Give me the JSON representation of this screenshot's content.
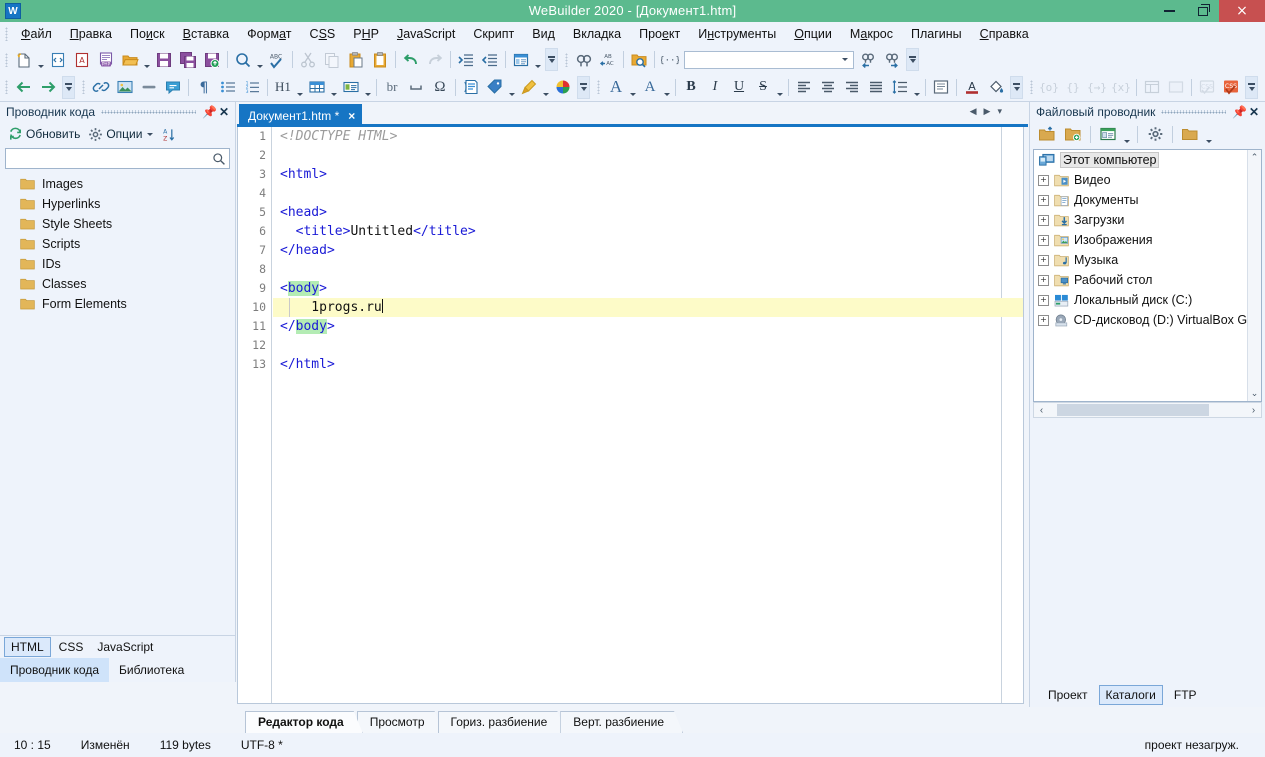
{
  "window": {
    "title": "WeBuilder 2020 - [Документ1.htm]",
    "app_icon": "W",
    "accent_title_bg": "#5cba8e",
    "close_btn_bg": "#c75050",
    "minimize_label": "minimize-icon",
    "maximize_label": "restore-icon",
    "close_label": "×"
  },
  "menubar": {
    "items": [
      {
        "label": "Файл",
        "accel_index": 0
      },
      {
        "label": "Правка",
        "accel_index": 0
      },
      {
        "label": "Поиск",
        "accel_index": 2
      },
      {
        "label": "Вставка",
        "accel_index": 0
      },
      {
        "label": "Формат",
        "accel_index": 4
      },
      {
        "label": "CSS",
        "accel_index": 2
      },
      {
        "label": "PHP",
        "accel_index": 1
      },
      {
        "label": "JavaScript",
        "accel_index": 0
      },
      {
        "label": "Скрипт",
        "accel_index": -1
      },
      {
        "label": "Вид",
        "accel_index": -1
      },
      {
        "label": "Вкладка",
        "accel_index": -1
      },
      {
        "label": "Проект",
        "accel_index": 3
      },
      {
        "label": "Инструменты",
        "accel_index": 2
      },
      {
        "label": "Опции",
        "accel_index": 0
      },
      {
        "label": "Макрос",
        "accel_index": 1
      },
      {
        "label": "Плагины",
        "accel_index": -1
      },
      {
        "label": "Справка",
        "accel_index": 0
      }
    ]
  },
  "toolbar_row1": {
    "items": [
      {
        "name": "new-file-icon",
        "type": "button"
      },
      {
        "name": "new-file-dropdown",
        "type": "caret"
      },
      {
        "name": "new-from-template-icon",
        "type": "button"
      },
      {
        "name": "new-asp-icon",
        "type": "button"
      },
      {
        "name": "new-php-icon",
        "type": "button"
      },
      {
        "name": "open-file-icon",
        "type": "button"
      },
      {
        "name": "open-file-dropdown",
        "type": "caret"
      },
      {
        "name": "save-icon",
        "type": "button"
      },
      {
        "name": "save-all-icon",
        "type": "button"
      },
      {
        "name": "save-upload-icon",
        "type": "button"
      },
      {
        "name": "separator",
        "type": "sep"
      },
      {
        "name": "preview-search-icon",
        "type": "button"
      },
      {
        "name": "preview-dropdown",
        "type": "caret"
      },
      {
        "name": "spellcheck-icon",
        "type": "button"
      },
      {
        "name": "separator",
        "type": "sep"
      },
      {
        "name": "cut-icon",
        "type": "button",
        "disabled": true
      },
      {
        "name": "copy-icon",
        "type": "button",
        "disabled": true
      },
      {
        "name": "paste-icon",
        "type": "button"
      },
      {
        "name": "clipboard-icon",
        "type": "button"
      },
      {
        "name": "separator",
        "type": "sep"
      },
      {
        "name": "undo-icon",
        "type": "button"
      },
      {
        "name": "redo-icon",
        "type": "button",
        "disabled": true
      },
      {
        "name": "separator",
        "type": "sep"
      },
      {
        "name": "indent-icon",
        "type": "button"
      },
      {
        "name": "outdent-icon",
        "type": "button"
      },
      {
        "name": "separator",
        "type": "sep"
      },
      {
        "name": "layout-icon",
        "type": "button"
      },
      {
        "name": "layout-dropdown",
        "type": "caret"
      },
      {
        "name": "overflow-chevron",
        "type": "more"
      },
      {
        "name": "grip",
        "type": "grip"
      },
      {
        "name": "find-icon",
        "type": "button"
      },
      {
        "name": "replace-icon",
        "type": "button"
      },
      {
        "name": "separator",
        "type": "sep"
      },
      {
        "name": "find-in-files-icon",
        "type": "button"
      },
      {
        "name": "separator",
        "type": "sep"
      },
      {
        "name": "snippet-icon",
        "type": "button"
      },
      {
        "name": "quick-find-combo",
        "type": "combo",
        "value": "",
        "placeholder": ""
      },
      {
        "name": "find-previous-icon",
        "type": "button"
      },
      {
        "name": "find-next-icon",
        "type": "button"
      },
      {
        "name": "overflow-chevron",
        "type": "more"
      }
    ]
  },
  "toolbar_row2": {
    "items": [
      {
        "name": "back-icon",
        "type": "button"
      },
      {
        "name": "forward-icon",
        "type": "button"
      },
      {
        "name": "overflow-chevron",
        "type": "more"
      },
      {
        "name": "grip",
        "type": "grip"
      },
      {
        "name": "insert-link-icon",
        "type": "button"
      },
      {
        "name": "insert-image-icon",
        "type": "button"
      },
      {
        "name": "horizontal-rule-icon",
        "type": "button"
      },
      {
        "name": "comment-icon",
        "type": "button"
      },
      {
        "name": "separator",
        "type": "sep"
      },
      {
        "name": "paragraph-icon",
        "type": "button"
      },
      {
        "name": "bullet-list-icon",
        "type": "button"
      },
      {
        "name": "numbered-list-icon",
        "type": "button"
      },
      {
        "name": "separator",
        "type": "sep"
      },
      {
        "name": "heading-icon",
        "type": "button",
        "text": "H1"
      },
      {
        "name": "heading-dropdown",
        "type": "caret"
      },
      {
        "name": "table-icon",
        "type": "button"
      },
      {
        "name": "table-dropdown",
        "type": "caret"
      },
      {
        "name": "form-icon",
        "type": "button"
      },
      {
        "name": "form-dropdown",
        "type": "caret"
      },
      {
        "name": "separator",
        "type": "sep"
      },
      {
        "name": "line-break-icon",
        "type": "button",
        "text": "br"
      },
      {
        "name": "nbsp-icon",
        "type": "button"
      },
      {
        "name": "special-char-icon",
        "type": "button"
      },
      {
        "name": "separator",
        "type": "sep"
      },
      {
        "name": "meta-tags-icon",
        "type": "button"
      },
      {
        "name": "tag-icon",
        "type": "button"
      },
      {
        "name": "tag-dropdown",
        "type": "caret"
      },
      {
        "name": "style-brush-icon",
        "type": "button"
      },
      {
        "name": "style-dropdown",
        "type": "caret"
      },
      {
        "name": "color-picker-icon",
        "type": "button"
      },
      {
        "name": "overflow-chevron",
        "type": "more"
      },
      {
        "name": "grip",
        "type": "grip"
      },
      {
        "name": "font-icon",
        "type": "button",
        "text": "A"
      },
      {
        "name": "font-dropdown",
        "type": "caret"
      },
      {
        "name": "font-size-icon",
        "type": "button",
        "text": "A"
      },
      {
        "name": "font-size-dropdown",
        "type": "caret"
      },
      {
        "name": "separator",
        "type": "sep"
      },
      {
        "name": "bold-icon",
        "type": "button",
        "text": "B"
      },
      {
        "name": "italic-icon",
        "type": "button",
        "text": "I"
      },
      {
        "name": "underline-icon",
        "type": "button",
        "text": "U"
      },
      {
        "name": "strikethrough-icon",
        "type": "button",
        "text": "S"
      },
      {
        "name": "strikethrough-dropdown",
        "type": "caret"
      },
      {
        "name": "separator",
        "type": "sep"
      },
      {
        "name": "align-left-icon",
        "type": "button"
      },
      {
        "name": "align-center-icon",
        "type": "button"
      },
      {
        "name": "align-right-icon",
        "type": "button"
      },
      {
        "name": "align-justify-icon",
        "type": "button"
      },
      {
        "name": "line-height-icon",
        "type": "button"
      },
      {
        "name": "line-height-dropdown",
        "type": "caret"
      },
      {
        "name": "separator",
        "type": "sep"
      },
      {
        "name": "div-block-icon",
        "type": "button"
      },
      {
        "name": "separator",
        "type": "sep"
      },
      {
        "name": "font-color-icon",
        "type": "button"
      },
      {
        "name": "background-color-icon",
        "type": "button"
      },
      {
        "name": "overflow-chevron",
        "type": "more"
      },
      {
        "name": "grip",
        "type": "grip"
      },
      {
        "name": "php-open-icon",
        "type": "button",
        "disabled": true
      },
      {
        "name": "php-braces-icon",
        "type": "button",
        "disabled": true
      },
      {
        "name": "php-echo-icon",
        "type": "button",
        "disabled": true
      },
      {
        "name": "php-var-icon",
        "type": "button",
        "disabled": true
      },
      {
        "name": "separator",
        "type": "sep"
      },
      {
        "name": "frame-icon",
        "type": "button",
        "disabled": true
      },
      {
        "name": "panel-icon",
        "type": "button",
        "disabled": true
      },
      {
        "name": "separator",
        "type": "sep"
      },
      {
        "name": "css-validate-icon",
        "type": "button",
        "disabled": true
      },
      {
        "name": "css-check-icon",
        "type": "button"
      },
      {
        "name": "overflow-chevron",
        "type": "more"
      }
    ]
  },
  "left_panel": {
    "title": "Проводник кода",
    "pin_icon": "pin-icon",
    "close_icon": "close-icon",
    "toolbar": {
      "refresh_label": "Обновить",
      "options_label": "Опции",
      "sort_label": "sort-az-icon"
    },
    "search": {
      "value": "",
      "placeholder": ""
    },
    "tree_items": [
      {
        "label": "Images",
        "icon": "folder-icon"
      },
      {
        "label": "Hyperlinks",
        "icon": "folder-icon"
      },
      {
        "label": "Style Sheets",
        "icon": "folder-icon"
      },
      {
        "label": "Scripts",
        "icon": "folder-icon"
      },
      {
        "label": "IDs",
        "icon": "folder-icon"
      },
      {
        "label": "Classes",
        "icon": "folder-icon"
      },
      {
        "label": "Form Elements",
        "icon": "folder-icon"
      }
    ],
    "lang_buttons": [
      {
        "label": "HTML",
        "active": true
      },
      {
        "label": "CSS",
        "active": false
      },
      {
        "label": "JavaScript",
        "active": false
      }
    ],
    "bottom_tabs": [
      {
        "label": "Проводник кода",
        "active": true
      },
      {
        "label": "Библиотека",
        "active": false
      }
    ]
  },
  "editor": {
    "document_tab": {
      "label": "Документ1.htm *",
      "close": "×"
    },
    "nav": {
      "prev": "◀",
      "next": "▶",
      "list": "▾"
    },
    "lines": [
      {
        "num": 1,
        "segments": [
          {
            "text": "<!DOCTYPE HTML>",
            "cls": "tok-doctype"
          }
        ]
      },
      {
        "num": 2,
        "segments": []
      },
      {
        "num": 3,
        "segments": [
          {
            "text": "<html>",
            "cls": "tok-tag"
          }
        ]
      },
      {
        "num": 4,
        "segments": []
      },
      {
        "num": 5,
        "segments": [
          {
            "text": "<head>",
            "cls": "tok-tag"
          }
        ]
      },
      {
        "num": 6,
        "segments": [
          {
            "text": "  <title>",
            "cls": "tok-tag"
          },
          {
            "text": "Untitled",
            "cls": "tok-txt"
          },
          {
            "text": "</title>",
            "cls": "tok-tag"
          }
        ]
      },
      {
        "num": 7,
        "segments": [
          {
            "text": "</head>",
            "cls": "tok-tag"
          }
        ]
      },
      {
        "num": 8,
        "segments": []
      },
      {
        "num": 9,
        "segments": [
          {
            "text": "<",
            "cls": "tok-tag"
          },
          {
            "text": "body",
            "cls": "tok-match"
          },
          {
            "text": ">",
            "cls": "tok-tag"
          }
        ]
      },
      {
        "num": 10,
        "current": true,
        "segments": [
          {
            "text": "    1progs.ru",
            "cls": "tok-txt"
          }
        ],
        "caret": true
      },
      {
        "num": 11,
        "segments": [
          {
            "text": "</",
            "cls": "tok-tag"
          },
          {
            "text": "body",
            "cls": "tok-match"
          },
          {
            "text": ">",
            "cls": "tok-tag"
          }
        ]
      },
      {
        "num": 12,
        "segments": []
      },
      {
        "num": 13,
        "segments": [
          {
            "text": "</html>",
            "cls": "tok-tag"
          }
        ]
      }
    ],
    "view_tabs": [
      {
        "label": "Редактор кода",
        "active": true
      },
      {
        "label": "Просмотр",
        "active": false
      },
      {
        "label": "Гориз. разбиение",
        "active": false
      },
      {
        "label": "Верт. разбиение",
        "active": false
      }
    ]
  },
  "right_panel": {
    "title": "Файловый проводник",
    "pin_icon": "pin-icon",
    "close_icon": "close-icon",
    "toolbar": [
      {
        "name": "parent-folder-icon"
      },
      {
        "name": "new-folder-icon"
      },
      {
        "name": "view-mode-icon"
      },
      {
        "name": "view-mode-dropdown"
      },
      {
        "name": "settings-gear-icon"
      },
      {
        "name": "bookmark-folder-icon"
      },
      {
        "name": "bookmark-dropdown"
      }
    ],
    "tree_items": [
      {
        "label": "Этот компьютер",
        "icon": "computer-icon",
        "selected": true,
        "expandable": false
      },
      {
        "label": "Видео",
        "icon": "folder-video-icon",
        "expandable": true
      },
      {
        "label": "Документы",
        "icon": "folder-documents-icon",
        "expandable": true
      },
      {
        "label": "Загрузки",
        "icon": "folder-downloads-icon",
        "expandable": true
      },
      {
        "label": "Изображения",
        "icon": "folder-pictures-icon",
        "expandable": true
      },
      {
        "label": "Музыка",
        "icon": "folder-music-icon",
        "expandable": true
      },
      {
        "label": "Рабочий стол",
        "icon": "folder-desktop-icon",
        "expandable": true
      },
      {
        "label": "Локальный диск (C:)",
        "icon": "drive-icon",
        "expandable": true
      },
      {
        "label": "CD-дисковод (D:) VirtualBox Gue",
        "icon": "cd-drive-icon",
        "expandable": true
      }
    ],
    "scroll": {
      "up": "⌃",
      "down": "⌄",
      "left": "‹",
      "right": "›"
    },
    "bottom_tabs": [
      {
        "label": "Проект",
        "active": false
      },
      {
        "label": "Каталоги",
        "active": true
      },
      {
        "label": "FTP",
        "active": false
      }
    ]
  },
  "statusbar": {
    "position": "10 : 15",
    "modified": "Изменён",
    "size": "119 bytes",
    "encoding": "UTF-8 *",
    "project_status": "проект незагруж."
  }
}
